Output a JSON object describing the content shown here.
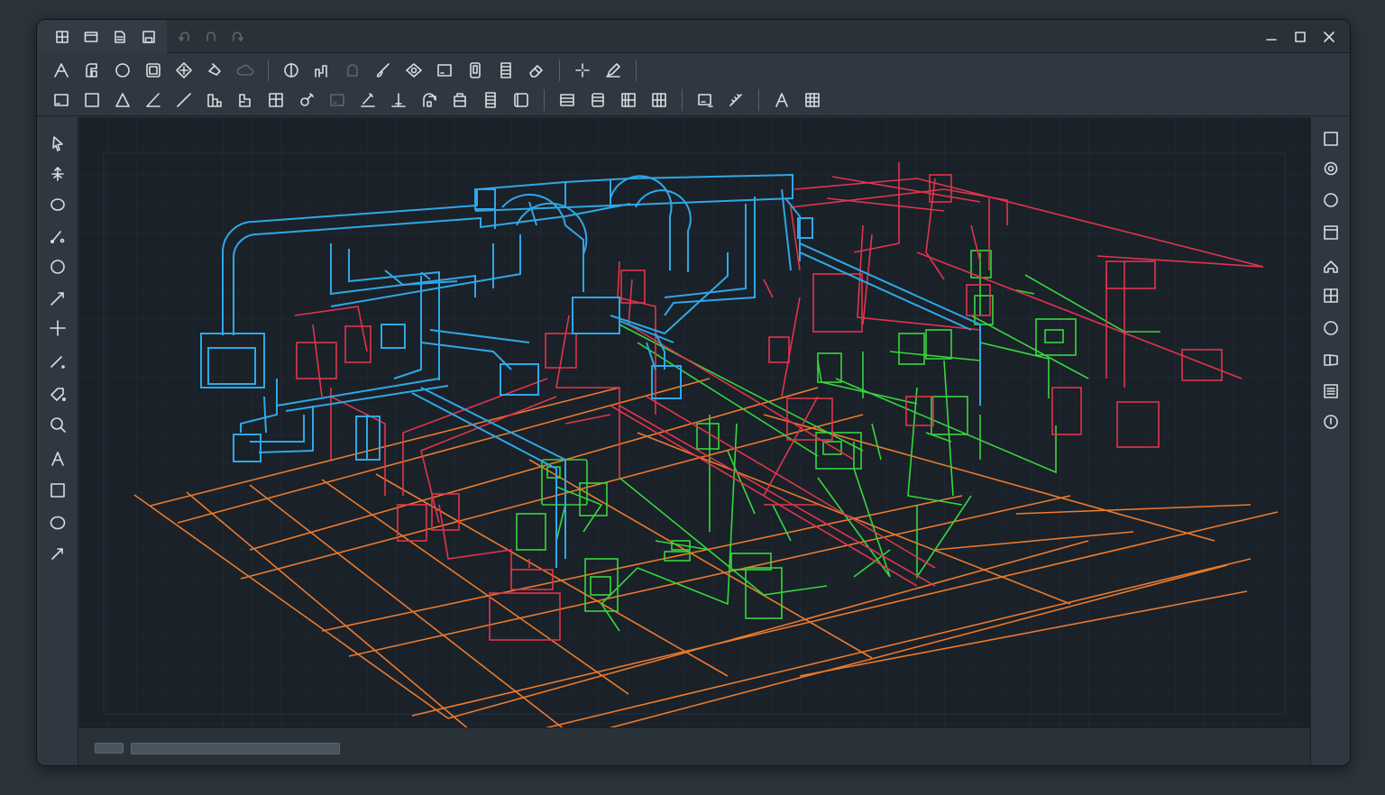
{
  "app": {
    "window_controls": [
      "minimize-icon",
      "maximize-icon",
      "close-icon"
    ]
  },
  "quick_access": [
    "grid-icon",
    "new-file-icon",
    "open-file-icon",
    "save-icon"
  ],
  "quick_access_disabled": [
    "undo-icon",
    "redo-icon",
    "refresh-icon"
  ],
  "ribbon": {
    "row1": [
      "polyline-icon",
      "duct-fitting-icon",
      "circle-icon",
      "component-icon",
      "diamond-icon",
      "paint-icon",
      "cloud-icon",
      "section-icon",
      "pipe-fitting-icon",
      "fixture-icon",
      "brush-icon",
      "view-icon",
      "window-icon",
      "tag-icon",
      "schedule-icon",
      "eraser-icon",
      "snap-icon",
      "pencil-icon"
    ],
    "row2": [
      "rectangle-icon",
      "square-icon",
      "triangle-icon",
      "angle-icon",
      "line-icon",
      "building-icon",
      "stairs-icon",
      "grid-layout-icon",
      "hook-icon",
      "box-icon",
      "ruler-icon",
      "elevation-icon",
      "valve-icon",
      "cabinet-icon",
      "stack-icon",
      "panel-icon",
      "table-icon",
      "sheet-icon",
      "matrix-icon",
      "wide-matrix-icon",
      "monitor-icon",
      "measure-icon",
      "text-icon",
      "table-grid-icon"
    ]
  },
  "left_tools": [
    "select-arrow-icon",
    "move-icon",
    "ellipse-icon",
    "line-point-icon",
    "circle-icon",
    "arrow-line-icon",
    "crosshair-icon",
    "dimension-icon",
    "tag-icon",
    "zoom-icon",
    "text-icon",
    "rectangle-icon",
    "circle-icon",
    "arrow-icon"
  ],
  "right_tools": [
    "square-icon",
    "target-icon",
    "circle-icon",
    "panel-icon",
    "house-icon",
    "grid-icon",
    "circle-icon",
    "book-icon",
    "list-icon",
    "info-icon"
  ],
  "colors": {
    "duct": "#2fa8e6",
    "plumbing": "#e0354b",
    "electrical": "#37d63c",
    "floor": "#ec7a2b",
    "background": "#1a2129",
    "chrome": "#2f3840"
  }
}
